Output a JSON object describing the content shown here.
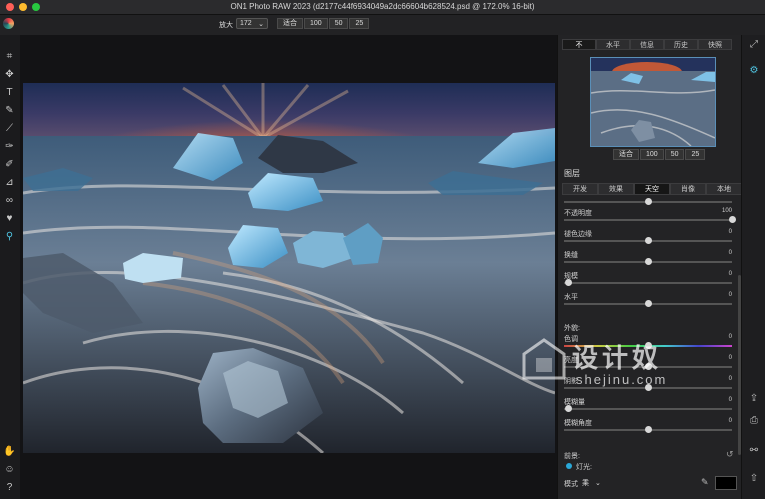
{
  "window": {
    "title": "ON1 Photo RAW 2023 (d2177c44f6934049a2dc66604b628524.psd @ 172.0% 16-bit)",
    "traffic_colors": [
      "#ff5f57",
      "#febc2e",
      "#28c840"
    ]
  },
  "toolbar": {
    "zoom_label": "放大",
    "zoom_value": "172",
    "zoom_buttons": [
      "适合",
      "100",
      "50",
      "25"
    ]
  },
  "left_tools": [
    "crop-icon",
    "move-icon",
    "text-icon",
    "brush-icon",
    "line-icon",
    "paint-icon",
    "retouch-icon",
    "gradient-icon",
    "clone-icon",
    "heart-icon",
    "zoom-icon"
  ],
  "navigator": {
    "tabs": [
      "不",
      "水平",
      "信息",
      "历史",
      "快照"
    ],
    "zoom_buttons": [
      "适合",
      "100",
      "50",
      "25"
    ]
  },
  "layers": {
    "title": "图层",
    "tabs": [
      "开发",
      "效果",
      "天空",
      "肖像",
      "本地"
    ],
    "active_tab": "天空"
  },
  "sliders": [
    {
      "label": "",
      "value": "",
      "pos": 0.5
    },
    {
      "label": "不透明度",
      "value": "100",
      "pos": 1.0
    },
    {
      "label": "褪色边缘",
      "value": "0",
      "pos": 0.5
    },
    {
      "label": "换缝",
      "value": "0",
      "pos": 0.5
    },
    {
      "label": "规模",
      "value": "0",
      "pos": 0.0
    },
    {
      "label": "水平",
      "value": "0",
      "pos": 0.5
    }
  ],
  "appearance": {
    "title": "外貌:",
    "sliders": [
      {
        "label": "色调",
        "value": "0",
        "pos": 0.5
      },
      {
        "label": "亮度",
        "value": "0",
        "pos": 0.5
      },
      {
        "label": "阴影",
        "value": "0",
        "pos": 0.5
      },
      {
        "label": "模糊量",
        "value": "0",
        "pos": 0.0
      },
      {
        "label": "模糊角度",
        "value": "0",
        "pos": 0.5
      }
    ]
  },
  "foreground": {
    "title": "前景:",
    "light_label": "灯光:",
    "mode_label": "模式",
    "mode_value": "乘",
    "swatch_color": "#000000",
    "accent": "#2aa8d8"
  },
  "watermark": {
    "cn": "设计奴",
    "url": "shejinu.com"
  }
}
